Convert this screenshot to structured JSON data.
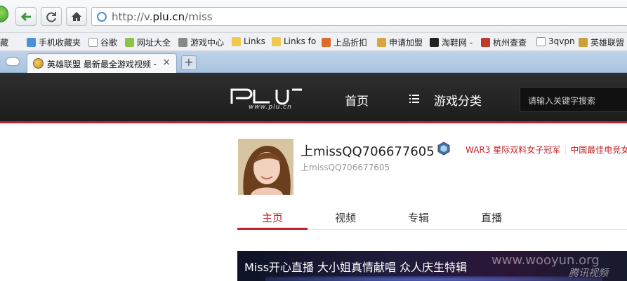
{
  "browser": {
    "url_prefix": "http://v.",
    "url_domain": "plu.cn",
    "url_path": "/miss",
    "bookmarks": [
      {
        "label": "藏",
        "icon": "folder-icon"
      },
      {
        "label": "手机收藏夹",
        "icon": "phone-icon"
      },
      {
        "label": "谷歌",
        "icon": "page-icon"
      },
      {
        "label": "网址大全",
        "icon": "plus-circle-icon"
      },
      {
        "label": "游戏中心",
        "icon": "gamepad-icon"
      },
      {
        "label": "Links",
        "icon": "folder-icon"
      },
      {
        "label": "Links fo",
        "icon": "folder-icon"
      },
      {
        "label": "上品折扣",
        "icon": "grid-icon"
      },
      {
        "label": "申请加盟",
        "icon": "person-icon"
      },
      {
        "label": "淘鞋网 -",
        "icon": "tao-icon"
      },
      {
        "label": "杭州查查",
        "icon": "flower-icon"
      },
      {
        "label": "3qvpn",
        "icon": "page-icon"
      },
      {
        "label": "英雄联盟",
        "icon": "lol-icon"
      }
    ],
    "tab": {
      "title": "英雄联盟 最新最全游戏视频 -",
      "close": "×",
      "new_tab": "+"
    }
  },
  "site": {
    "logo_sub": "www.plu.cn",
    "nav": {
      "home": "首页",
      "categories": "游戏分类"
    },
    "search_placeholder": "请输入关键字搜索"
  },
  "profile": {
    "name": "上missQQ706677605",
    "id": "上missQQ706677605",
    "honors": [
      "WAR3 星际双料女子冠军",
      "中国最佳电竞女"
    ],
    "tabs": [
      {
        "label": "主页",
        "active": true
      },
      {
        "label": "视频",
        "active": false
      },
      {
        "label": "专辑",
        "active": false
      },
      {
        "label": "直播",
        "active": false
      }
    ]
  },
  "video": {
    "title": "Miss开心直播 大小姐真情献唱 众人庆生特辑",
    "watermark": "www.wooyun.org",
    "brand": "腾讯视频"
  },
  "colors": {
    "accent": "#c0242a",
    "header_bg": "#252525"
  }
}
